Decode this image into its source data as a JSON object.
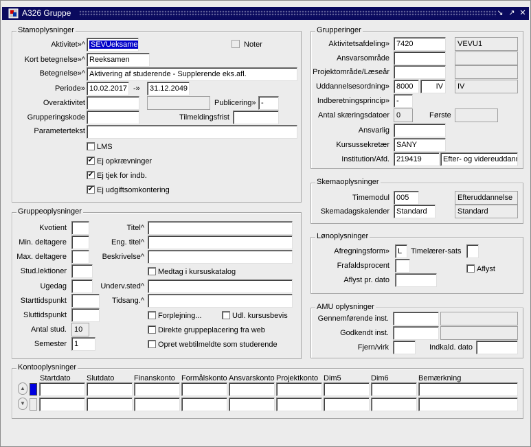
{
  "window": {
    "title": "A326 Gruppe"
  },
  "icons": {
    "app": "app-icon",
    "min": "minimize-icon",
    "max": "maximize-icon",
    "close": "close-icon",
    "up": "chevron-up-icon",
    "down": "chevron-down-icon"
  },
  "stamp": {
    "title": "Stamoplysninger",
    "aktivitet_label": "Aktivitet»^",
    "aktivitet_value": "SEVUeksamen",
    "noter_label": "Noter",
    "kort_label": "Kort betegnelse»^",
    "kort_value": "Reeksamen",
    "beteg_label": "Betegnelse»^",
    "beteg_value": "Aktivering af studerende - Supplerende eks.afl.",
    "periode_label": "Periode»",
    "periode_from": "10.02.2017",
    "periode_arrow": "-»",
    "periode_to": "31.12.2049",
    "overakt_label": "Overaktivitet",
    "publ_label": "Publicering»",
    "publ_value": "-",
    "grupkode_label": "Grupperingskode",
    "tilm_label": "Tilmeldingsfrist",
    "param_label": "Parametertekst",
    "lms_label": "LMS",
    "ejopk_label": "Ej opkrævninger",
    "ejtjek_label": "Ej tjek for indb.",
    "ejudg_label": "Ej udgiftsomkontering",
    "lms_checked": false,
    "ejopk_checked": true,
    "ejtjek_checked": true,
    "ejudg_checked": true
  },
  "gruppe": {
    "title": "Gruppeoplysninger",
    "kvotient": "Kvotient",
    "min": "Min. deltagere",
    "max": "Max. deltagere",
    "studlek": "Stud.lektioner",
    "ugedag": "Ugedag",
    "start": "Starttidspunkt",
    "slut": "Sluttidspunkt",
    "antal": "Antal stud.",
    "antal_value": "10",
    "semester": "Semester",
    "semester_value": "1",
    "titel": "Titel^",
    "engtitel": "Eng. titel^",
    "beskr": "Beskrivelse^",
    "medtag": "Medtag i kursuskatalog",
    "underv": "Underv.sted^",
    "tidsang": "Tidsang.^",
    "forpl": "Forplejning...",
    "udl": "Udl. kursusbevis",
    "direkte": "Direkte gruppeplacering fra web",
    "opret": "Opret webtilmeldte som studerende"
  },
  "grupp": {
    "title": "Grupperinger",
    "aktafd": "Aktivitetsafdeling»",
    "aktafd_value": "7420",
    "aktafd_name": "VEVU1",
    "ansv": "Ansvarsområde",
    "proj": "Projektområde/Læseår",
    "udd": "Uddannelsesordning»",
    "udd_value": "8000",
    "udd_code": "IV",
    "udd_name": "IV",
    "indb": "Indberetningsprincip»",
    "indb_value": "-",
    "antal": "Antal skæringsdatoer",
    "antal_value": "0",
    "forste": "Første",
    "ansvarlig": "Ansvarlig",
    "sekr": "Kursussekretær",
    "sekr_value": "SANY",
    "inst": "Institution/Afd.",
    "inst_value": "219419",
    "inst_name": "Efter- og videreuddannelse"
  },
  "skema": {
    "title": "Skemaoplysninger",
    "timemodul": "Timemodul",
    "timemodul_value": "005",
    "timemodul_name": "Efteruddannelse",
    "kal": "Skemadagskalender",
    "kal_value": "Standard",
    "kal_name": "Standard"
  },
  "lon": {
    "title": "Lønoplysninger",
    "afr": "Afregningsform»",
    "afr_value": "L",
    "timel": "Timelærer-sats",
    "fraf": "Frafaldsprocent",
    "aflyst": "Aflyst",
    "aflystdato": "Aflyst pr. dato"
  },
  "amu": {
    "title": "AMU oplysninger",
    "gennem": "Gennemførende inst.",
    "godk": "Godkendt inst.",
    "fjern": "Fjern/virk",
    "indk": "Indkald. dato"
  },
  "konto": {
    "title": "Kontooplysninger",
    "columns": [
      "Startdato",
      "Slutdato",
      "Finanskonto",
      "Formålskonto",
      "Ansvarskonto",
      "Projektkonto",
      "Dim5",
      "Dim6",
      "Bemærkning"
    ]
  }
}
